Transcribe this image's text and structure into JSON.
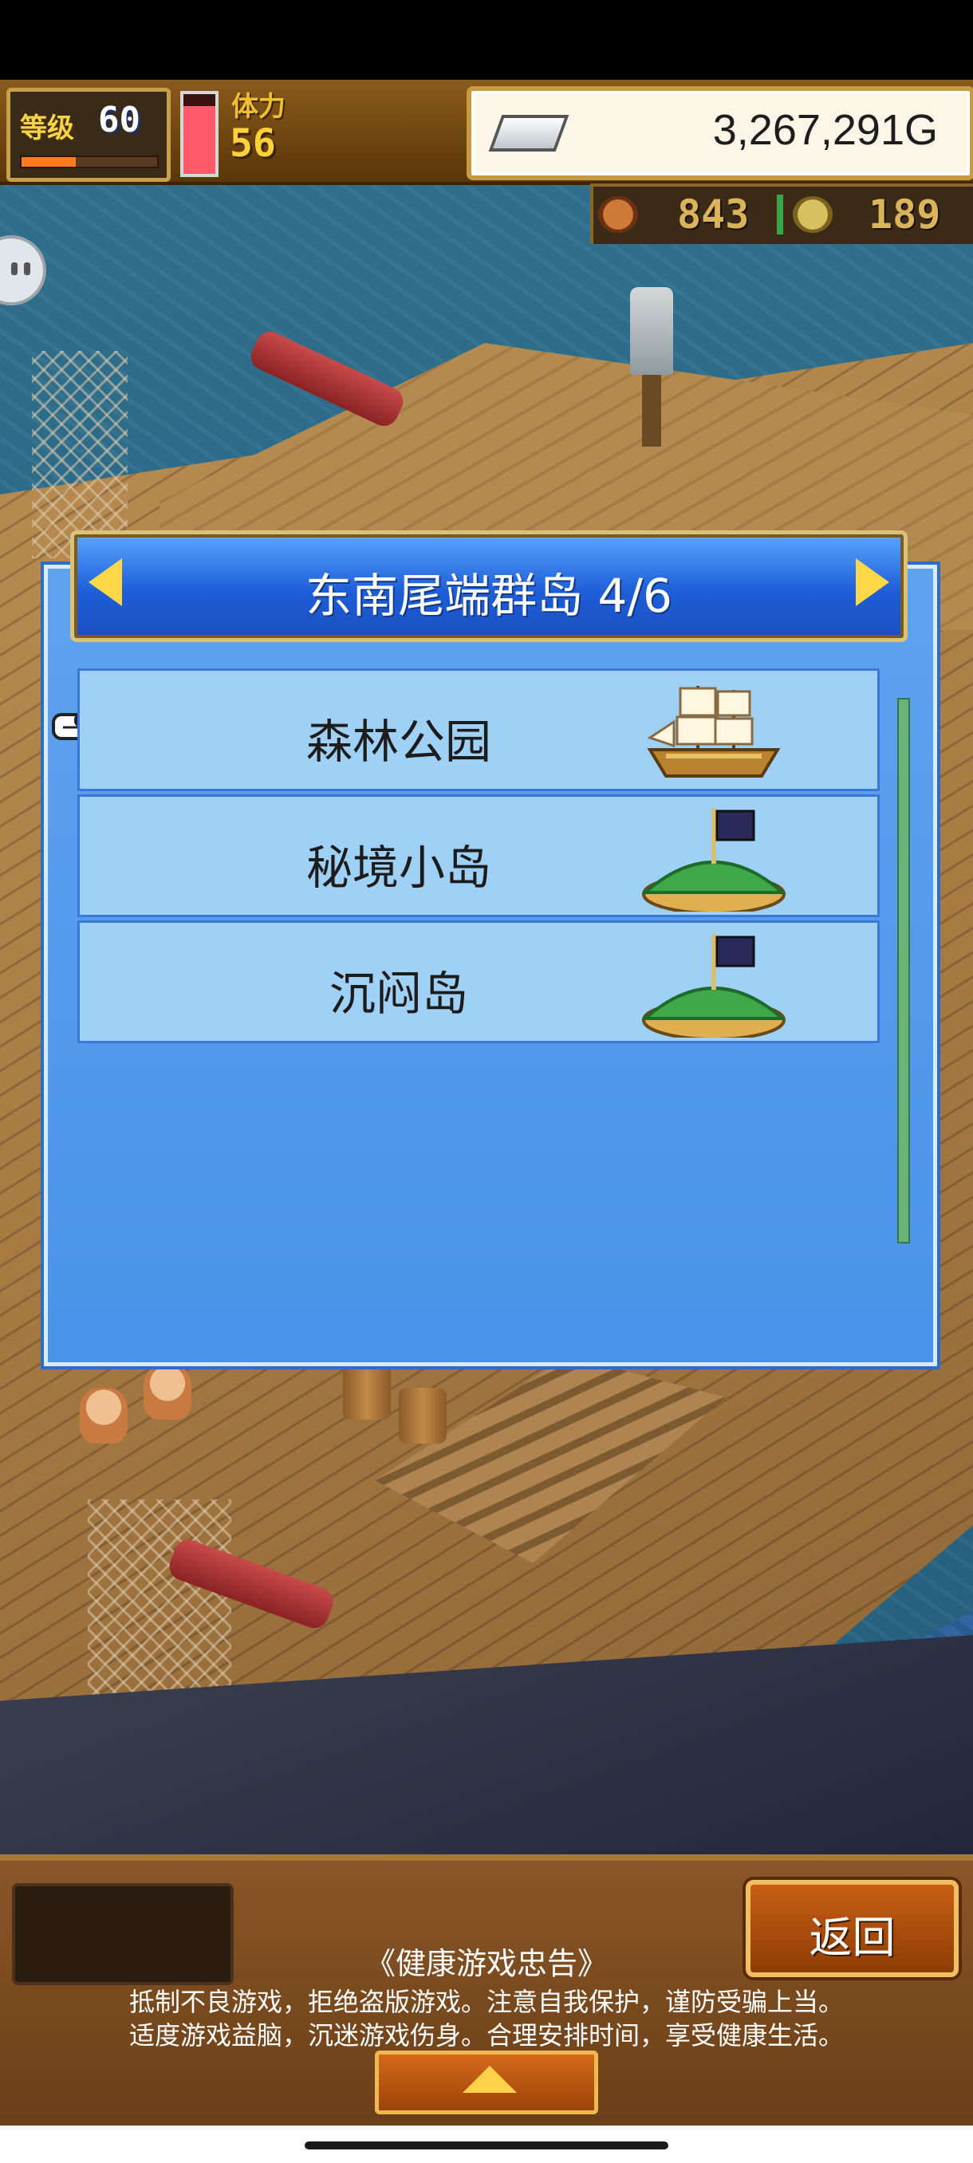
{
  "hud": {
    "level_label": "等级",
    "level_value": "60",
    "level_progress": 0.4,
    "stamina_label": "体力",
    "stamina_value": "56",
    "stamina_fill": 0.85,
    "gold_value": "3,267,291G",
    "resource_1_icon": "meat-icon",
    "resource_1_value": "843",
    "resource_2_icon": "coin-icon",
    "resource_2_value": "189"
  },
  "dialog": {
    "title": "东南尾端群岛 4/6",
    "prev_icon": "arrow-left-icon",
    "next_icon": "arrow-right-icon",
    "items": [
      {
        "label": "森林公园",
        "icon": "ship-icon",
        "selected": true
      },
      {
        "label": "秘境小岛",
        "icon": "island-flag-icon"
      },
      {
        "label": "沉闷岛",
        "icon": "island-flag-icon"
      }
    ]
  },
  "bottom": {
    "back_label": "返回",
    "notice_title": "《健康游戏忠告》",
    "notice_line1": "抵制不良游戏，拒绝盗版游戏。注意自我保护，谨防受骗上当。",
    "notice_line2": "适度游戏益脑，沉迷游戏伤身。合理安排时间，享受健康生活。"
  },
  "colors": {
    "dialog_blue": "#4a92ea",
    "item_bg": "#9fd0f5",
    "header_gold": "#d9c37a",
    "wood": "#8a5626"
  }
}
